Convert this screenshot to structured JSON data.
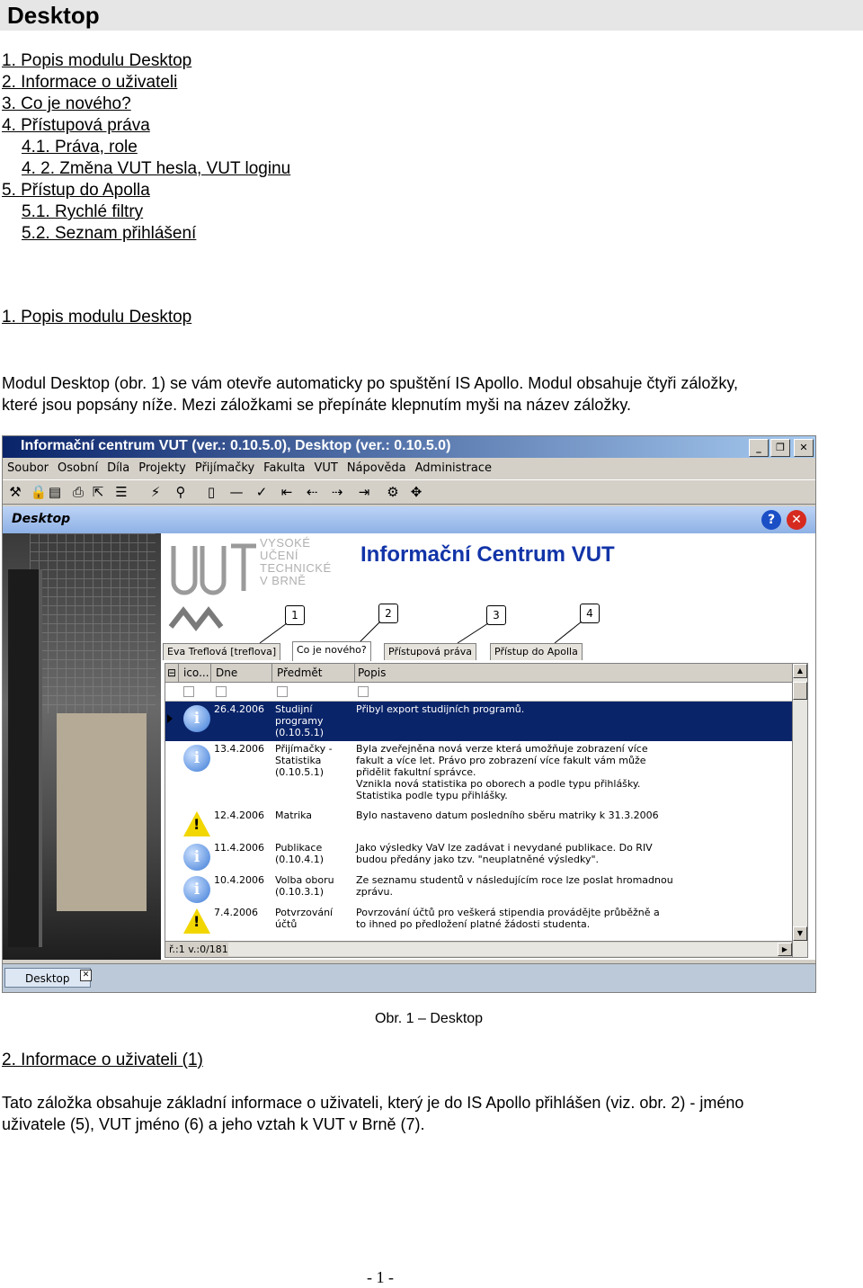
{
  "page_title": "Desktop",
  "toc": [
    {
      "label": "1. Popis modulu Desktop",
      "indent": false
    },
    {
      "label": "2. Informace o uživateli",
      "indent": false
    },
    {
      "label": "3. Co je nového?",
      "indent": false
    },
    {
      "label": "4. Přístupová práva",
      "indent": false
    },
    {
      "label": "4.1. Práva, role",
      "indent": true
    },
    {
      "label": "4. 2. Změna VUT hesla, VUT loginu",
      "indent": true
    },
    {
      "label": "5. Přístup do Apolla",
      "indent": false
    },
    {
      "label": "5.1. Rychlé filtry",
      "indent": true
    },
    {
      "label": "5.2. Seznam přihlášení",
      "indent": true
    }
  ],
  "section1": {
    "heading": "1. Popis modulu Desktop",
    "line1": "Modul Desktop (obr. 1) se vám otevře automaticky po spuštění IS Apollo.  Modul obsahuje čtyři záložky,",
    "line2": "které jsou popsány níže. Mezi záložkami se přepínáte klepnutím myši na název záložky."
  },
  "screenshot": {
    "window_title": "Informační centrum VUT (ver.: 0.10.5.0), Desktop (ver.: 0.10.5.0)",
    "menu": [
      "Soubor",
      "Osobní",
      "Díla",
      "Projekty",
      "Přijímačky",
      "Fakulta",
      "VUT",
      "Nápověda",
      "Administrace"
    ],
    "toolbar_icons": [
      "tools-icon",
      "lock-icon",
      "folder-icon",
      "printer-icon",
      "export-icon",
      "list-icon",
      "lightning-icon",
      "binoculars-icon",
      "page-icon",
      "minus-icon",
      "check-icon",
      "first-icon",
      "prev-icon",
      "next-icon",
      "last-icon",
      "gears-icon",
      "move-icon"
    ],
    "desktop_label": "Desktop",
    "help_glyph": "?",
    "close_glyph": "✕",
    "university_name": [
      "VYSOKÉ",
      "UČENÍ",
      "TECHNICKÉ",
      "V BRNĚ"
    ],
    "center_title": "Informační Centrum VUT",
    "callouts": [
      "1",
      "2",
      "3",
      "4"
    ],
    "tabs": [
      "Eva Treflová  [treflova]",
      "Co je nového?",
      "Přístupová práva",
      "Přístup do Apolla"
    ],
    "grid_headers": [
      "ico...",
      "Dne",
      "Předmět",
      "Popis"
    ],
    "rows": [
      {
        "icon": "info",
        "date": "26.4.2006",
        "subject": [
          "Studijní",
          "programy",
          "(0.10.5.1)"
        ],
        "desc": [
          "Přibyl export studijních programů."
        ],
        "selected": true
      },
      {
        "icon": "info",
        "date": "13.4.2006",
        "subject": [
          "Přijímačky -",
          "Statistika",
          "(0.10.5.1)"
        ],
        "desc": [
          "Byla zveřejněna nová verze která umožňuje zobrazení více",
          "fakult a více let. Právo pro zobrazení více fakult vám může",
          "přidělit fakultní správce.",
          "Vznikla nová statistika po oborech a podle typu přihlášky.",
          "Statistika podle typu přihlášky."
        ],
        "selected": false
      },
      {
        "icon": "warn",
        "date": "12.4.2006",
        "subject": [
          "Matrika"
        ],
        "desc": [
          "Bylo nastaveno datum posledního sběru matriky k 31.3.2006"
        ],
        "selected": false
      },
      {
        "icon": "info",
        "date": "11.4.2006",
        "subject": [
          "Publikace",
          "(0.10.4.1)"
        ],
        "desc": [
          "Jako výsledky VaV lze zadávat i nevydané publikace. Do RIV",
          "budou předány jako tzv. \"neuplatněné výsledky\"."
        ],
        "selected": false
      },
      {
        "icon": "info",
        "date": "10.4.2006",
        "subject": [
          "Volba oboru",
          "(0.10.3.1)"
        ],
        "desc": [
          "Ze seznamu studentů v následujícím roce lze poslat hromadnou",
          "zprávu."
        ],
        "selected": false
      },
      {
        "icon": "warn",
        "date": "7.4.2006",
        "subject": [
          "Potvrzování",
          "účtů"
        ],
        "desc": [
          "Povrzování účtů pro veškerá stipendia provádějte průběžně a",
          "to ihned po předložení platné žádosti studenta."
        ],
        "selected": false
      }
    ],
    "status_text": "ř.:1 v.:0/181",
    "taskbar_item": "Desktop"
  },
  "figure_caption": "Obr. 1 – Desktop",
  "section2": {
    "heading": "2. Informace o uživateli (1)",
    "line1": "Tato záložka obsahuje základní informace o uživateli, který je do IS Apollo přihlášen (viz. obr. 2) - jméno",
    "line2": "uživatele (5),  VUT jméno (6) a jeho vztah k VUT v Brně (7)."
  },
  "page_number": "- 1 -",
  "colors": {
    "titlebar_start": "#0a246a",
    "titlebar_end": "#a6caf0",
    "center_title": "#1234a8",
    "selected_row": "#0a246a",
    "warning": "#f2d600"
  }
}
